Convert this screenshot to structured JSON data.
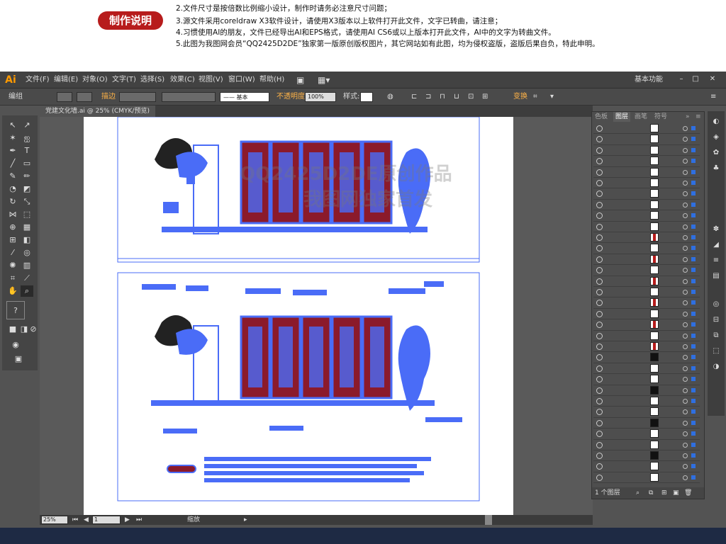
{
  "banner": {
    "badge": "制作说明",
    "notes": [
      "2.文件尺寸是按倍数比例缩小设计，制作时请务必注意尺寸问题；",
      "3.源文件采用coreldraw X3软件设计，请使用X3版本以上软件打开此文件，文字已转曲，请注意；",
      "4.习惯使用AI的朋友，文件已经导出AI和EPS格式，请使用AI CS6或以上版本打开此文件，AI中的文字为转曲文件。",
      "5.此图为我图网会员“QQ2425D2DE”独家第一版原创版权图片，其它网站如有此图，均为侵权盗版，盗版后果自负，特此申明。"
    ]
  },
  "app": {
    "logo": "Ai",
    "menus": [
      "文件(F)",
      "编辑(E)",
      "对象(O)",
      "文字(T)",
      "选择(S)",
      "效果(C)",
      "视图(V)",
      "窗口(W)",
      "帮助(H)"
    ],
    "workspace": "基本功能",
    "window_controls": [
      "–",
      "□",
      "✕"
    ]
  },
  "control_bar": {
    "group_label": "编组",
    "stroke_label": "描边",
    "stroke_style": "—— 基本",
    "opacity_label": "不透明度",
    "opacity_value": "100%",
    "style_label": "样式:",
    "transform_label": "变换"
  },
  "document": {
    "tab_title": "党建文化墙.ai @ 25% (CMYK/预览)",
    "watermark_line1": "QQ2425D2DE原创作品",
    "watermark_line2": "我图网独家首发"
  },
  "status_bar": {
    "zoom": "25%",
    "page": "1",
    "tool_name": "缩放"
  },
  "layers_panel": {
    "tabs": [
      "色板",
      "图层",
      "画笔",
      "符号"
    ],
    "active_tab": "图层",
    "row_count": 33,
    "footer": "1 个图层"
  },
  "colors": {
    "accent_red": "#b71c1c",
    "selection_blue": "#4a6cf7",
    "panel_gray": "#535353",
    "ai_orange": "#ff9a00"
  }
}
